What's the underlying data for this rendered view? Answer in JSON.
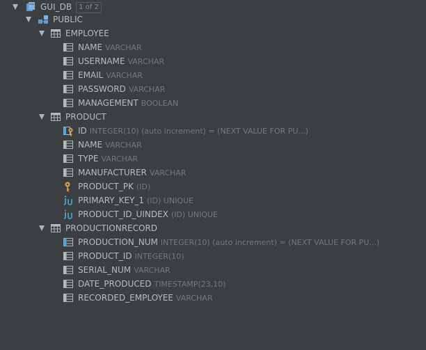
{
  "tree": {
    "db": {
      "name": "GUI_DB",
      "badge": "1 of 2"
    },
    "schema": {
      "name": "PUBLIC"
    },
    "employee": {
      "name": "EMPLOYEE",
      "cols": [
        {
          "name": "NAME",
          "type": "VARCHAR"
        },
        {
          "name": "USERNAME",
          "type": "VARCHAR"
        },
        {
          "name": "EMAIL",
          "type": "VARCHAR"
        },
        {
          "name": "PASSWORD",
          "type": "VARCHAR"
        },
        {
          "name": "MANAGEMENT",
          "type": "BOOLEAN"
        }
      ]
    },
    "product": {
      "name": "PRODUCT",
      "cols": [
        {
          "name": "ID",
          "type": "INTEGER(10) (auto increment) = (NEXT VALUE FOR PU...)"
        },
        {
          "name": "NAME",
          "type": "VARCHAR"
        },
        {
          "name": "TYPE",
          "type": "VARCHAR"
        },
        {
          "name": "MANUFACTURER",
          "type": "VARCHAR"
        }
      ],
      "keys": [
        {
          "name": "PRODUCT_PK",
          "type": "(ID)"
        },
        {
          "name": "PRIMARY_KEY_1",
          "type": "(ID) UNIQUE"
        },
        {
          "name": "PRODUCT_ID_UINDEX",
          "type": "(ID) UNIQUE"
        }
      ]
    },
    "productionrecord": {
      "name": "PRODUCTIONRECORD",
      "cols": [
        {
          "name": "PRODUCTION_NUM",
          "type": "INTEGER(10) (auto increment) = (NEXT VALUE FOR PU...)"
        },
        {
          "name": "PRODUCT_ID",
          "type": "INTEGER(10)"
        },
        {
          "name": "SERIAL_NUM",
          "type": "VARCHAR"
        },
        {
          "name": "DATE_PRODUCED",
          "type": "TIMESTAMP(23,10)"
        },
        {
          "name": "RECORDED_EMPLOYEE",
          "type": "VARCHAR"
        }
      ]
    }
  },
  "colors": {
    "background": "#3c3f41",
    "text": "#bbbbbb",
    "type_text": "#787878",
    "key_icon": "#d9a343",
    "index_icon": "#4aa6d6",
    "table_icon": "#aeb9c0"
  },
  "icons": {
    "db": "database-icon",
    "schema": "schema-icon",
    "table": "table-icon",
    "column": "column-icon",
    "pk_column": "primary-key-column-icon",
    "auto_column": "auto-increment-column-icon",
    "key": "key-icon",
    "unique_index": "unique-index-icon"
  }
}
